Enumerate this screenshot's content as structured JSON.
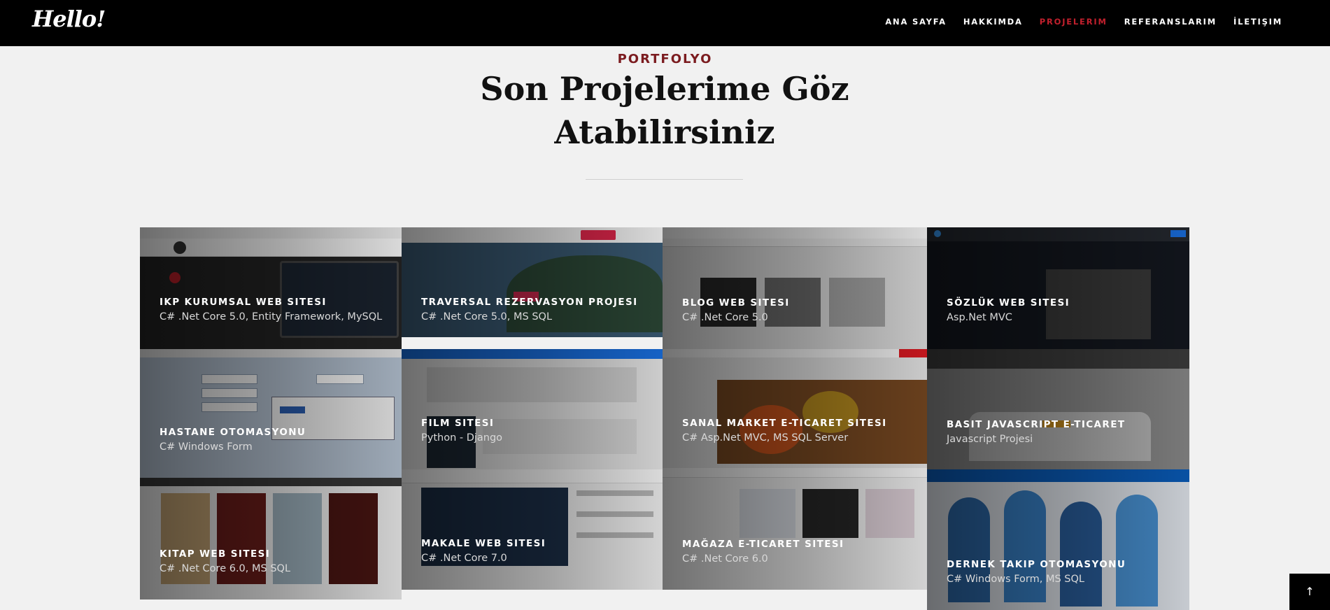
{
  "brand": {
    "logo": "Hello!"
  },
  "nav": {
    "items": [
      {
        "label": "ANA SAYFA",
        "active": false
      },
      {
        "label": "HAKKIMDA",
        "active": false
      },
      {
        "label": "PROJELERIM",
        "active": true
      },
      {
        "label": "REFERANSLARIM",
        "active": false
      },
      {
        "label": "İLETIŞIM",
        "active": false
      }
    ]
  },
  "section": {
    "eyebrow": "PORTFOLYO",
    "title_line1": "Son Projelerime Göz",
    "title_line2": "Atabilirsiniz"
  },
  "projects": [
    {
      "title": "IKP KURUMSAL WEB SITESI",
      "tech": "C# .Net Core 5.0, Entity Framework, MySQL"
    },
    {
      "title": "TRAVERSAL REZERVASYON PROJESI",
      "tech": "C# .Net Core 5.0, MS SQL"
    },
    {
      "title": "BLOG WEB SITESI",
      "tech": "C# .Net Core 5.0"
    },
    {
      "title": "SÖZLÜK WEB SITESI",
      "tech": "Asp.Net MVC"
    },
    {
      "title": "HASTANE OTOMASYONU",
      "tech": "C# Windows Form"
    },
    {
      "title": "FILM SITESI",
      "tech": "Python - Django"
    },
    {
      "title": "SANAL MARKET E-TICARET SITESI",
      "tech": "C# Asp.Net MVC, MS SQL Server"
    },
    {
      "title": "BASIT JAVASCRIPT E-TICARET",
      "tech": "Javascript Projesi"
    },
    {
      "title": "KITAP WEB SITESI",
      "tech": "C# .Net Core 6.0, MS SQL"
    },
    {
      "title": "MAKALE WEB SITESI",
      "tech": "C# .Net Core 7.0"
    },
    {
      "title": "MAĞAZA E-TICARET SITESI",
      "tech": "C# .Net Core 6.0"
    },
    {
      "title": "DERNEK TAKIP OTOMASYONU",
      "tech": "C# Windows Form, MS SQL"
    }
  ],
  "scroll_top": {
    "icon": "arrow-up-icon",
    "glyph": "↑"
  },
  "colors": {
    "accent": "#c2202d",
    "eyebrow": "#7b1b1f",
    "navbar": "#000000",
    "page": "#f1f1f1"
  }
}
